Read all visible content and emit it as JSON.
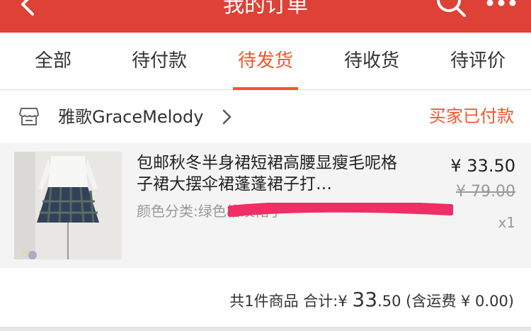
{
  "header": {
    "title": "我的订单",
    "icons": [
      "back-arrow-icon",
      "search-icon",
      "more-icon"
    ],
    "bg_color": "#de4136"
  },
  "tabs": [
    {
      "label": "全部",
      "active": false
    },
    {
      "label": "待付款",
      "active": false
    },
    {
      "label": "待发货",
      "active": true
    },
    {
      "label": "待收货",
      "active": false
    },
    {
      "label": "待评价",
      "active": false
    }
  ],
  "accent_color": "#f1562a",
  "order": {
    "shop_name": "雅歌GraceMelody",
    "status": "买家已付款",
    "item": {
      "title": "包邮秋冬半身裙短裙高腰显瘦毛呢格子裙大摆伞裙蓬蓬裙子打…",
      "sku": "颜色分类:绿色格纹裙子",
      "price": "¥ 33.50",
      "original_price": "¥ 79.00",
      "quantity": "x1"
    },
    "summary": {
      "count_text": "共1件商品 合计:",
      "currency": "¥",
      "total_int": "33",
      "total_dec": ".50",
      "shipping": "(含运费 ¥ 0.00)"
    }
  }
}
